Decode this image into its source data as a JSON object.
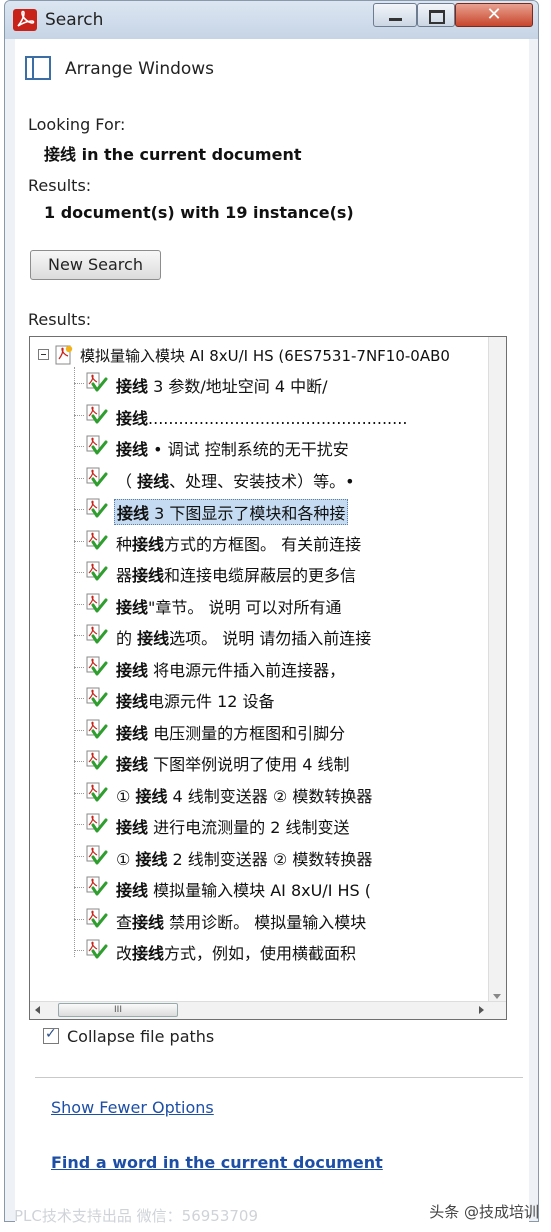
{
  "window": {
    "title": "Search",
    "close_glyph": "✕"
  },
  "arrange": {
    "label": "Arrange Windows"
  },
  "looking_for": {
    "label": "Looking For:",
    "term": "接线",
    "scope": " in the current document"
  },
  "results_summary": {
    "label": "Results:",
    "value": "1 document(s) with 19 instance(s)"
  },
  "new_search": {
    "label": "New Search"
  },
  "results_list": {
    "label": "Results:",
    "document": "模拟量输入模块 AI 8xU/I HS (6ES7531-7NF10-0AB0",
    "scrollbar_thumb": "III",
    "items": [
      {
        "pre": "",
        "term": "接线",
        "post": " 3 参数/地址空间 4 中断/"
      },
      {
        "pre": "",
        "term": "接线",
        "post": "..................................................."
      },
      {
        "pre": "",
        "term": "接线",
        "post": " • 调试 控制系统的无干扰安"
      },
      {
        "pre": "（ ",
        "term": "接线",
        "post": "、处理、安装技术）等。•"
      },
      {
        "pre": "",
        "term": "接线",
        "post": " 3 下图显示了模块和各种接"
      },
      {
        "pre": "种",
        "term": "接线",
        "post": "方式的方框图。 有关前连接"
      },
      {
        "pre": "器",
        "term": "接线",
        "post": "和连接电缆屏蔽层的更多信"
      },
      {
        "pre": "",
        "term": "接线",
        "post": "\"章节。 说明 可以对所有通"
      },
      {
        "pre": "的 ",
        "term": "接线",
        "post": "选项。 说明 请勿插入前连接"
      },
      {
        "pre": "",
        "term": "接线",
        "post": " 将电源元件插入前连接器，"
      },
      {
        "pre": "",
        "term": "接线",
        "post": "电源元件 12 设备"
      },
      {
        "pre": "",
        "term": "接线",
        "post": " 电压测量的方框图和引脚分"
      },
      {
        "pre": "",
        "term": "接线",
        "post": " 下图举例说明了使用 4 线制"
      },
      {
        "pre": "① ",
        "term": "接线",
        "post": " 4 线制变送器 ② 模数转换器"
      },
      {
        "pre": "",
        "term": "接线",
        "post": " 进行电流测量的 2 线制变送"
      },
      {
        "pre": "① ",
        "term": "接线",
        "post": " 2 线制变送器 ② 模数转换器"
      },
      {
        "pre": "",
        "term": "接线",
        "post": " 模拟量输入模块 AI 8xU/I HS ("
      },
      {
        "pre": "查",
        "term": "接线",
        "post": " 禁用诊断。 模拟量输入模块"
      },
      {
        "pre": "改",
        "term": "接线",
        "post": "方式，例如，使用横截面积"
      }
    ],
    "selected_index": 4
  },
  "collapse_paths": {
    "label": "Collapse file paths",
    "checked": true
  },
  "links": {
    "show_fewer": "Show Fewer Options",
    "find_word": "Find a word in the current document"
  },
  "watermarks": {
    "left": "PLC技术支持出品  微信：56953709",
    "right": "头条 @技成培训"
  }
}
